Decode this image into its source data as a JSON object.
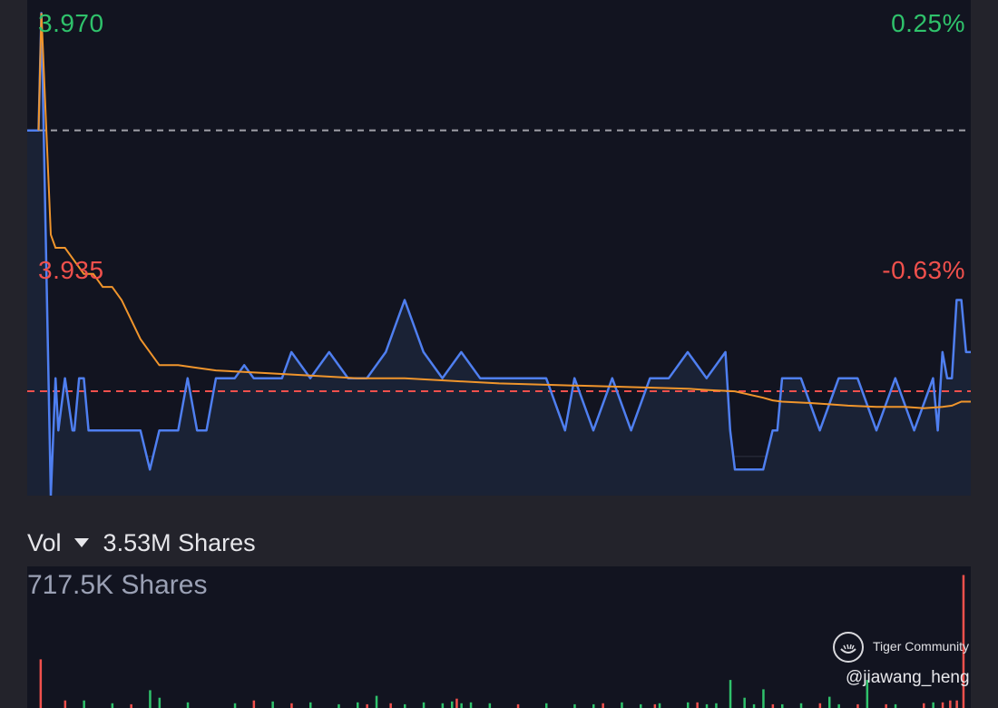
{
  "colors": {
    "background": "#23232b",
    "panel": "#121420",
    "price_line": "#4f7ff0",
    "avg_line": "#f0952c",
    "up": "#2fc26b",
    "down": "#f0504c",
    "ref_dashed": "#a0a0a8",
    "current_dashed": "#f0504c",
    "muted_text": "#9aa0b4"
  },
  "price_panel": {
    "price_high": "3.970",
    "price_low": "3.935",
    "pct_high": "0.25%",
    "pct_low": "-0.63%"
  },
  "volume_panel": {
    "label": "Vol",
    "dropdown_icon": "triangle-down-icon",
    "total": "3.53M Shares",
    "max_label": "717.5K Shares"
  },
  "watermark": {
    "brand": "Tiger Community",
    "user": "@jiawang_heng"
  },
  "chart_data": [
    {
      "type": "line",
      "ylim": [
        3.932,
        3.97
      ],
      "prev_close": 3.96,
      "current_price": 3.94,
      "series": [
        {
          "role": "price",
          "x": [
            0,
            1.2,
            1.5,
            2.5,
            3,
            3.3,
            4,
            4.8,
            5,
            5.5,
            6,
            6.5,
            7,
            7.5,
            8,
            9,
            10,
            11,
            12,
            13,
            14,
            15,
            16,
            17,
            18,
            19,
            20,
            21,
            22,
            23,
            24,
            25,
            26,
            27,
            28,
            30,
            32,
            34,
            36,
            38,
            40,
            42,
            44,
            46,
            48,
            50,
            52,
            55,
            57,
            58,
            60,
            62,
            64,
            66,
            68,
            70,
            72,
            74,
            74.5,
            75,
            76,
            77,
            78,
            79,
            79.5,
            80,
            82,
            84,
            86,
            88,
            90,
            92,
            94,
            96,
            96.5,
            97,
            97.5,
            98,
            98.5,
            99,
            99.5,
            100
          ],
          "values": [
            3.96,
            3.96,
            3.969,
            3.932,
            3.941,
            3.937,
            3.941,
            3.937,
            3.937,
            3.941,
            3.941,
            3.937,
            3.937,
            3.937,
            3.937,
            3.937,
            3.937,
            3.937,
            3.937,
            3.934,
            3.937,
            3.937,
            3.937,
            3.941,
            3.937,
            3.937,
            3.941,
            3.941,
            3.941,
            3.942,
            3.941,
            3.941,
            3.941,
            3.941,
            3.943,
            3.941,
            3.943,
            3.941,
            3.941,
            3.943,
            3.947,
            3.943,
            3.941,
            3.943,
            3.941,
            3.941,
            3.941,
            3.941,
            3.937,
            3.941,
            3.937,
            3.941,
            3.937,
            3.941,
            3.941,
            3.943,
            3.941,
            3.943,
            3.937,
            3.934,
            3.934,
            3.934,
            3.934,
            3.937,
            3.937,
            3.941,
            3.941,
            3.937,
            3.941,
            3.941,
            3.937,
            3.941,
            3.937,
            3.941,
            3.937,
            3.943,
            3.941,
            3.941,
            3.947,
            3.947,
            3.943,
            3.943
          ]
        },
        {
          "role": "average",
          "x": [
            1.2,
            1.5,
            2.5,
            3,
            4,
            5,
            6,
            7,
            8,
            9,
            10,
            12,
            14,
            16,
            18,
            20,
            25,
            30,
            35,
            40,
            45,
            50,
            55,
            60,
            65,
            70,
            72,
            75,
            78,
            79,
            80,
            83,
            85,
            87,
            90,
            93,
            95,
            97,
            98,
            99,
            100
          ],
          "values": [
            3.96,
            3.969,
            3.952,
            3.951,
            3.951,
            3.95,
            3.949,
            3.949,
            3.948,
            3.948,
            3.947,
            3.944,
            3.942,
            3.942,
            3.9418,
            3.9416,
            3.9414,
            3.9412,
            3.941,
            3.941,
            3.9408,
            3.9406,
            3.9405,
            3.9404,
            3.9403,
            3.9402,
            3.9401,
            3.94,
            3.9395,
            3.9393,
            3.9392,
            3.9391,
            3.939,
            3.9389,
            3.9388,
            3.9388,
            3.9387,
            3.9388,
            3.9389,
            3.9392,
            3.9392
          ]
        }
      ]
    },
    {
      "type": "bar",
      "ylim": [
        0,
        717.5
      ],
      "unit": "K Shares",
      "series": [
        {
          "role": "up",
          "x": [
            6,
            9,
            13,
            14,
            17,
            22,
            26,
            30,
            33,
            35,
            37,
            40,
            42,
            44,
            45,
            46,
            47,
            49,
            55,
            58,
            60,
            63,
            65,
            67,
            70,
            72,
            73,
            74.5,
            76,
            77,
            78,
            80,
            82,
            85,
            86,
            89,
            92,
            96,
            98.5
          ],
          "values": [
            40,
            25,
            95,
            55,
            30,
            25,
            35,
            30,
            20,
            30,
            65,
            20,
            30,
            25,
            35,
            25,
            30,
            25,
            25,
            20,
            20,
            30,
            20,
            25,
            30,
            20,
            25,
            150,
            55,
            20,
            100,
            20,
            25,
            60,
            20,
            150,
            20,
            30,
            25
          ]
        },
        {
          "role": "down",
          "x": [
            1.4,
            4,
            11,
            24,
            28,
            36,
            38.5,
            45.5,
            52,
            61,
            66.5,
            71,
            79,
            84,
            88,
            91,
            95,
            97,
            97.8,
            98.5,
            99.2
          ],
          "values": [
            260,
            40,
            20,
            40,
            25,
            20,
            25,
            50,
            20,
            25,
            20,
            30,
            20,
            25,
            20,
            20,
            25,
            30,
            40,
            40,
            710
          ]
        }
      ]
    }
  ]
}
